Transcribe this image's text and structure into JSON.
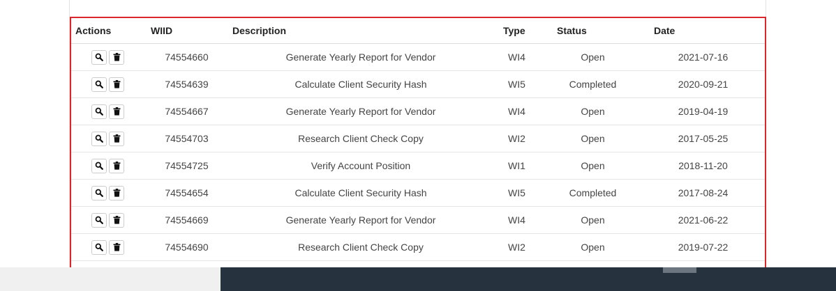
{
  "table": {
    "headers": {
      "actions": "Actions",
      "wiid": "WIID",
      "description": "Description",
      "type": "Type",
      "status": "Status",
      "date": "Date"
    },
    "rows": [
      {
        "wiid": "74554660",
        "description": "Generate Yearly Report for Vendor",
        "type": "WI4",
        "status": "Open",
        "date": "2021-07-16"
      },
      {
        "wiid": "74554639",
        "description": "Calculate Client Security Hash",
        "type": "WI5",
        "status": "Completed",
        "date": "2020-09-21"
      },
      {
        "wiid": "74554667",
        "description": "Generate Yearly Report for Vendor",
        "type": "WI4",
        "status": "Open",
        "date": "2019-04-19"
      },
      {
        "wiid": "74554703",
        "description": "Research Client Check Copy",
        "type": "WI2",
        "status": "Open",
        "date": "2017-05-25"
      },
      {
        "wiid": "74554725",
        "description": "Verify Account Position",
        "type": "WI1",
        "status": "Open",
        "date": "2018-11-20"
      },
      {
        "wiid": "74554654",
        "description": "Calculate Client Security Hash",
        "type": "WI5",
        "status": "Completed",
        "date": "2017-08-24"
      },
      {
        "wiid": "74554669",
        "description": "Generate Yearly Report for Vendor",
        "type": "WI4",
        "status": "Open",
        "date": "2021-06-22"
      },
      {
        "wiid": "74554690",
        "description": "Research Client Check Copy",
        "type": "WI2",
        "status": "Open",
        "date": "2019-07-22"
      }
    ],
    "row_actions": [
      "search-icon",
      "trash-icon"
    ]
  },
  "colors": {
    "highlight_border": "#d9262b",
    "footer_bar": "#26333f"
  }
}
